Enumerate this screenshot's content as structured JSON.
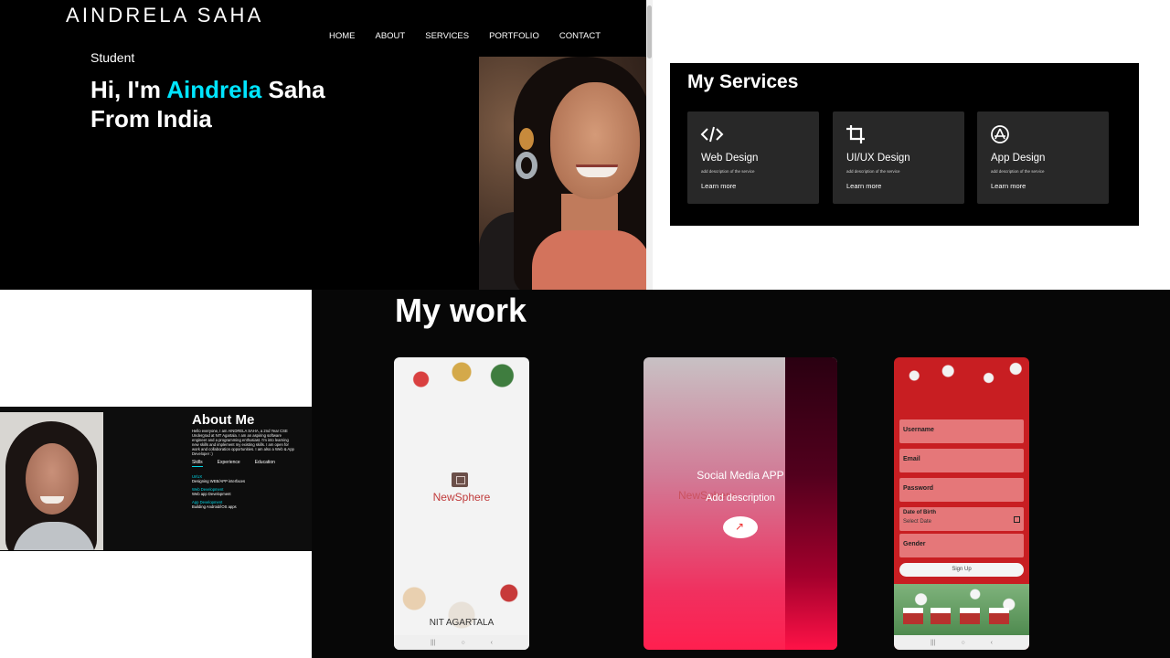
{
  "hero": {
    "logo": "AINDRELA SAHA",
    "nav": [
      "HOME",
      "ABOUT",
      "SERVICES",
      "PORTFOLIO",
      "CONTACT"
    ],
    "role": "Student",
    "greeting_prefix": "Hi, I'm ",
    "name_highlight": "Aindrela",
    "name_suffix": " Saha",
    "location": "From India",
    "accent_color": "#00e5ff"
  },
  "services": {
    "title": "My Services",
    "items": [
      {
        "icon": "code-icon",
        "name": "Web Design",
        "desc": "add description of the service",
        "link": "Learn more"
      },
      {
        "icon": "crop-icon",
        "name": "UI/UX Design",
        "desc": "add description of the service",
        "link": "Learn more"
      },
      {
        "icon": "app-store-icon",
        "name": "App Design",
        "desc": "add description of the service",
        "link": "Learn more"
      }
    ]
  },
  "about": {
    "title": "About Me",
    "bio": "Hello everyone, I am AINDRELA SAHA, a 2nd Year CSE Undergrad at NIT Agartala. I am an aspiring software engineer and a programming enthusiast. I'm into learning new skills and implement my existing skills. I am open for work and collaboration opportunities. I am also a Web & App Developer :)",
    "tabs": [
      "Skills",
      "Experience",
      "Education"
    ],
    "skills": [
      {
        "k": "UI/UX",
        "v": "Designing WEB/APP interfaces"
      },
      {
        "k": "Web Development",
        "v": "Web app Development"
      },
      {
        "k": "App Development",
        "v": "Building Android/iOS apps"
      }
    ]
  },
  "work": {
    "title": "My work",
    "p1": {
      "brand": "NewSphere",
      "footer": "NIT AGARTALA"
    },
    "p2": {
      "title": "Social Media APP",
      "desc": "Add description",
      "ghost": "NewSphere"
    },
    "p3": {
      "fields": [
        "Username",
        "Email",
        "Password",
        "Date of Birth",
        "Gender"
      ],
      "date_placeholder": "Select Date",
      "signup": "Sign Up"
    },
    "nav_glyphs": [
      "|||",
      "○",
      "‹"
    ]
  }
}
